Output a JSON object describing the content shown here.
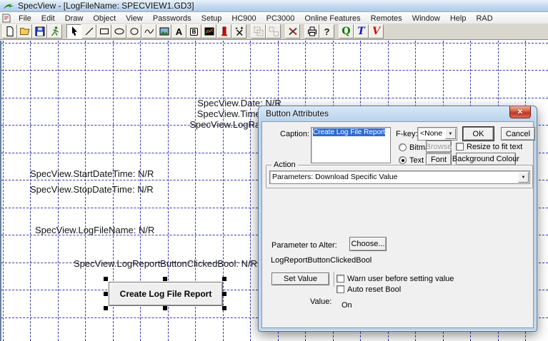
{
  "window": {
    "title": "SpecView - [LogFileName: SPECVIEW1.GD3]"
  },
  "menubar": {
    "items": [
      "File",
      "Edit",
      "Draw",
      "Object",
      "View",
      "Passwords",
      "Setup",
      "HC900",
      "PC3000",
      "Online Features",
      "Remotes",
      "Window",
      "Help",
      "RAD"
    ]
  },
  "toolbar": {
    "buttons": [
      "new",
      "open",
      "save",
      "run",
      "pointer",
      "line",
      "rectangle",
      "rounded-ellipse",
      "oval",
      "polyline",
      "image",
      "text",
      "button",
      "trend-chart",
      "bargraph",
      "recipe",
      "group",
      "ungroup",
      "tools",
      "print",
      "help",
      "quick-q",
      "trend-t",
      "variable-v"
    ],
    "glyphs": {
      "a": "A",
      "b": "B",
      "help": "?",
      "q": "Q",
      "t": "T",
      "v": "V"
    }
  },
  "icons": {
    "dropdown_arrow": "▼",
    "close": "✕"
  },
  "canvas": {
    "labels": [
      {
        "text": "SpecView.Date: N/R"
      },
      {
        "text": "SpecView.Time: N/R"
      },
      {
        "text": "SpecView.LogRate: N/R"
      },
      {
        "text": "SpecView.StartDateTime: N/R"
      },
      {
        "text": "SpecView.StopDateTime: N/R"
      },
      {
        "text": "SpecView.LogFileName: N/R"
      },
      {
        "text": "SpecView.LogReportButtonClickedBool: N/R"
      }
    ],
    "button_label": "Create Log File Report"
  },
  "dialog": {
    "title": "Button Attributes",
    "caption_label": "Caption:",
    "caption_value": "Create Log File Report",
    "fkey_label": "F-key:",
    "fkey_value": "<None",
    "ok": "OK",
    "cancel": "Cancel",
    "bitmap_label": "Bitmap",
    "browse": "Browse",
    "text_label": "Text",
    "font": "Font",
    "resize_label": "Resize to fit text",
    "background_colour": "Background Colour",
    "action_label": "Action",
    "action_value": "Parameters: Download Specific Value",
    "parameter_to_alter_label": "Parameter to Alter:",
    "choose": "Choose...",
    "parameter_name": "LogReportButtonClickedBool",
    "set_value": "Set Value",
    "warn_label": "Warn user before setting value",
    "auto_reset_label": "Auto reset Bool",
    "value_label": "Value:",
    "value": "On"
  }
}
